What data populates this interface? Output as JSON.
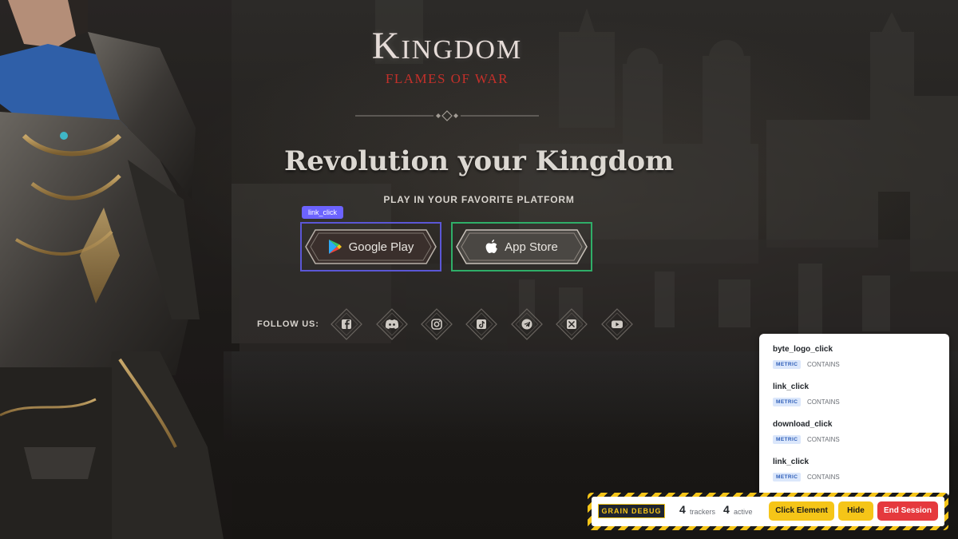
{
  "logo": {
    "title": "Kingdom",
    "subtitle": "Flames of War"
  },
  "hero": {
    "headline": "Revolution your Kingdom",
    "platform_caption": "PLAY IN YOUR FAVORITE PLATFORM"
  },
  "debug_tag": "link_click",
  "store_buttons": [
    {
      "label": "Google Play",
      "icon": "google-play-icon"
    },
    {
      "label": "App Store",
      "icon": "apple-icon"
    }
  ],
  "follow": {
    "label": "FOLLOW US:",
    "socials": [
      "facebook-icon",
      "discord-icon",
      "instagram-icon",
      "tiktok-icon",
      "telegram-icon",
      "x-icon",
      "youtube-icon"
    ]
  },
  "tracker_panel": {
    "items": [
      {
        "name": "byte_logo_click",
        "badge": "METRIC",
        "match": "CONTAINS"
      },
      {
        "name": "link_click",
        "badge": "METRIC",
        "match": "CONTAINS"
      },
      {
        "name": "download_click",
        "badge": "METRIC",
        "match": "CONTAINS"
      },
      {
        "name": "link_click",
        "badge": "METRIC",
        "match": "CONTAINS"
      }
    ]
  },
  "debug_bar": {
    "label": "GRAIN DEBUG",
    "trackers_count": "4",
    "trackers_label": "trackers",
    "active_count": "4",
    "active_label": "active",
    "click_element_label": "Click Element",
    "hide_label": "Hide",
    "end_session_label": "End Session"
  },
  "colors": {
    "accent_debug": "#f5c518",
    "tag_purple": "#6c63ff",
    "google_outline": "#5b57d6",
    "apple_outline": "#2fae68",
    "end_session": "#e5393d",
    "logo_red": "#c4302a"
  }
}
